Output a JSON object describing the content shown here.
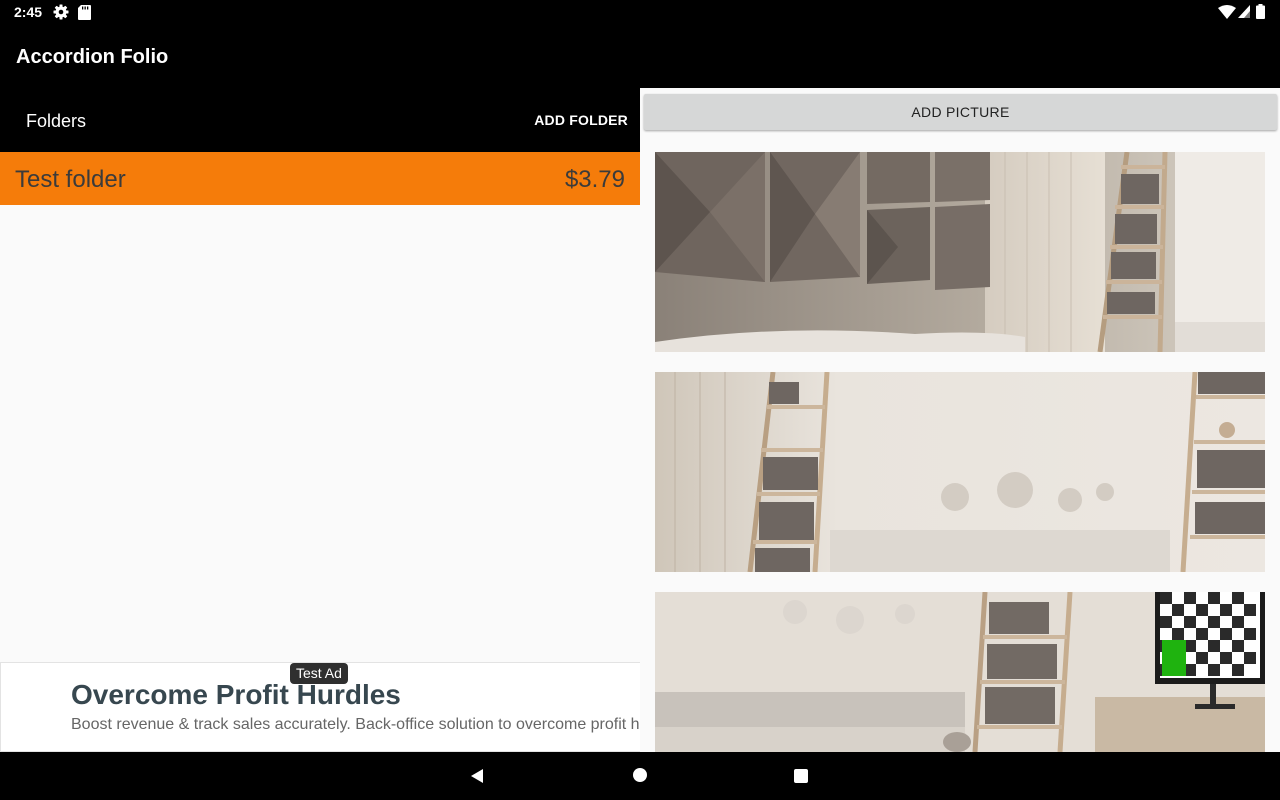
{
  "status_bar": {
    "time": "2:45",
    "icons": [
      "gear-icon",
      "sd-card-icon",
      "wifi-icon",
      "signal-icon",
      "battery-icon"
    ]
  },
  "app_bar": {
    "title": "Accordion Folio"
  },
  "folders_panel": {
    "title": "Folders",
    "add_folder_label": "ADD FOLDER",
    "items": [
      {
        "name": "Test folder",
        "price": "$3.79"
      }
    ],
    "accent_color": "#f57c0a"
  },
  "ad": {
    "badge": "Test Ad",
    "title": "Overcome Profit Hurdles",
    "text": "Boost revenue & track sales accurately. Back-office solution to overcome profit hurdles."
  },
  "pictures_panel": {
    "add_picture_label": "ADD PICTURE",
    "pictures": [
      "room-image-1",
      "room-image-2",
      "room-image-3"
    ]
  },
  "nav_bar": {
    "icons": [
      "back-icon",
      "home-icon",
      "recents-icon"
    ]
  }
}
